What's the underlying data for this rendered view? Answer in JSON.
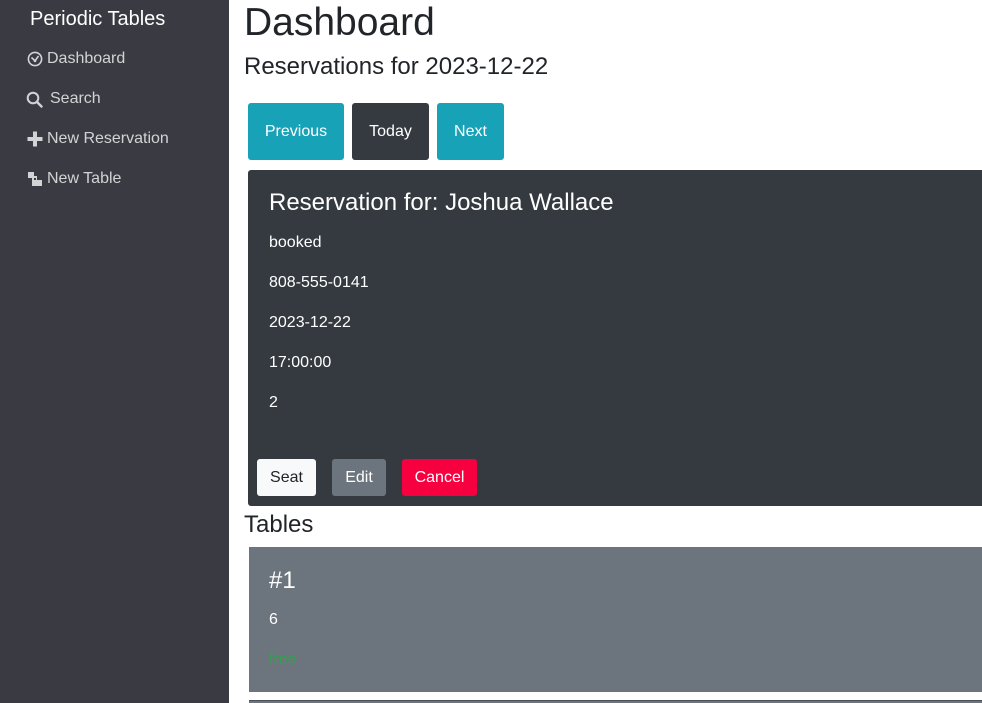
{
  "sidebar": {
    "brand": "Periodic Tables",
    "items": [
      {
        "label": "Dashboard",
        "icon": "dashboard-icon"
      },
      {
        "label": "Search",
        "icon": "search-icon"
      },
      {
        "label": "New Reservation",
        "icon": "plus-icon"
      },
      {
        "label": "New Table",
        "icon": "new-table-icon"
      }
    ]
  },
  "main": {
    "title": "Dashboard",
    "subtitle": "Reservations for 2023-12-22",
    "date_nav": {
      "previous": "Previous",
      "today": "Today",
      "next": "Next"
    },
    "reservation": {
      "title": "Reservation for: Joshua Wallace",
      "status": "booked",
      "phone": "808-555-0141",
      "date": "2023-12-22",
      "time": "17:00:00",
      "people": "2",
      "actions": {
        "seat": "Seat",
        "edit": "Edit",
        "cancel": "Cancel"
      }
    },
    "tables_heading": "Tables",
    "tables": [
      {
        "name": "#1",
        "capacity": "6",
        "status": "free"
      }
    ]
  },
  "colors": {
    "sidebar_bg": "#3a3a42",
    "info": "#17a2b8",
    "dark": "#343a40",
    "secondary": "#6c757d",
    "danger": "#f7003f",
    "success": "#28a745"
  }
}
